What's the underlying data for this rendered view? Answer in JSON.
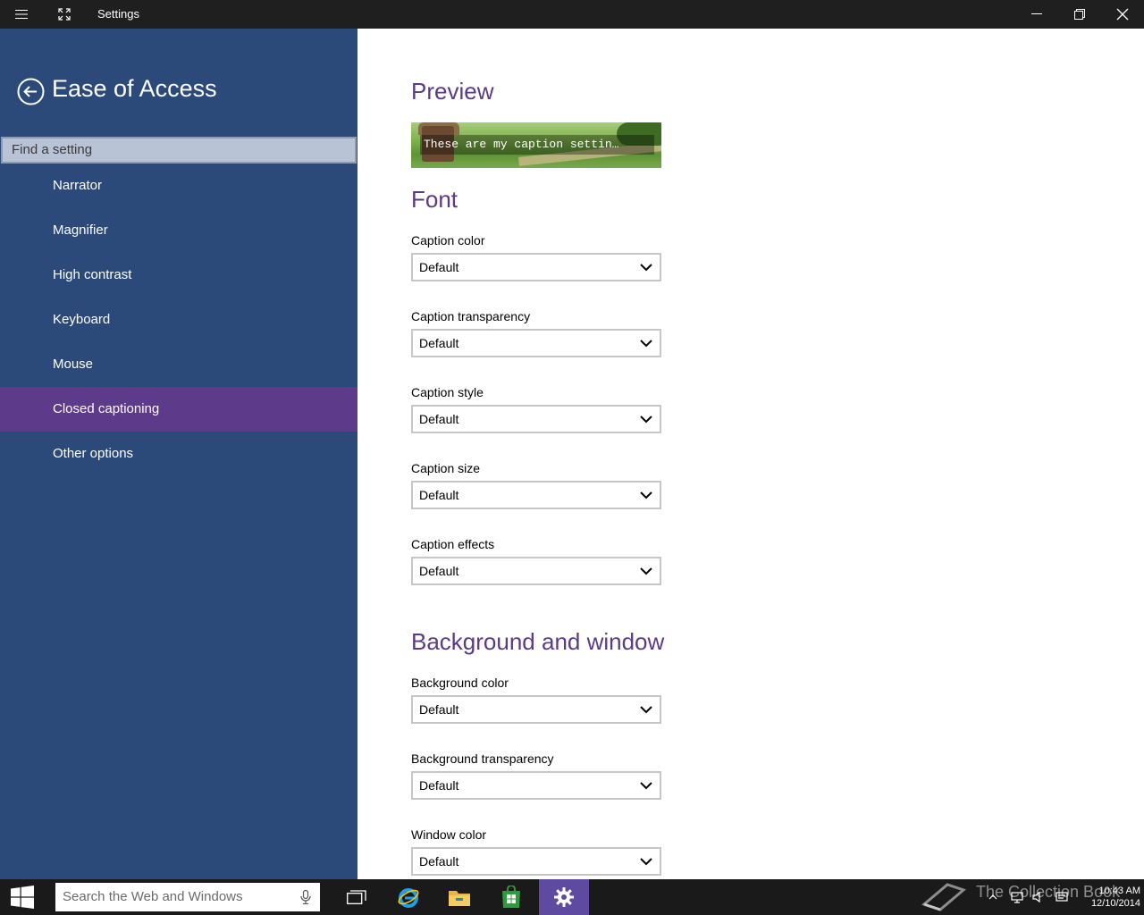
{
  "window": {
    "title": "Settings"
  },
  "sidebar": {
    "title": "Ease of Access",
    "search_placeholder": "Find a setting",
    "items": [
      {
        "label": "Narrator"
      },
      {
        "label": "Magnifier"
      },
      {
        "label": "High contrast"
      },
      {
        "label": "Keyboard"
      },
      {
        "label": "Mouse"
      },
      {
        "label": "Closed captioning",
        "active": true
      },
      {
        "label": "Other options"
      }
    ]
  },
  "main": {
    "preview": {
      "title": "Preview",
      "caption_text": "These are my caption settin…"
    },
    "font": {
      "title": "Font",
      "fields": [
        {
          "label": "Caption color",
          "value": "Default"
        },
        {
          "label": "Caption transparency",
          "value": "Default"
        },
        {
          "label": "Caption style",
          "value": "Default"
        },
        {
          "label": "Caption size",
          "value": "Default"
        },
        {
          "label": "Caption effects",
          "value": "Default"
        }
      ]
    },
    "background": {
      "title": "Background and window",
      "fields": [
        {
          "label": "Background color",
          "value": "Default"
        },
        {
          "label": "Background transparency",
          "value": "Default"
        },
        {
          "label": "Window color",
          "value": "Default"
        }
      ]
    }
  },
  "taskbar": {
    "search_placeholder": "Search the Web and Windows",
    "apps": [
      "task-view-icon",
      "internet-explorer-icon",
      "file-explorer-icon",
      "store-icon",
      "settings-icon"
    ],
    "time": "10:43 AM",
    "date": "12/10/2014",
    "watermark": "The Collection Book"
  },
  "colors": {
    "sidebar_bg": "#2b4a7a",
    "active_item": "#5e3a8a",
    "heading_accent": "#5b3a86",
    "titlebar_bg": "#1f1f1f",
    "taskbar_bg": "#1a1a1a"
  }
}
